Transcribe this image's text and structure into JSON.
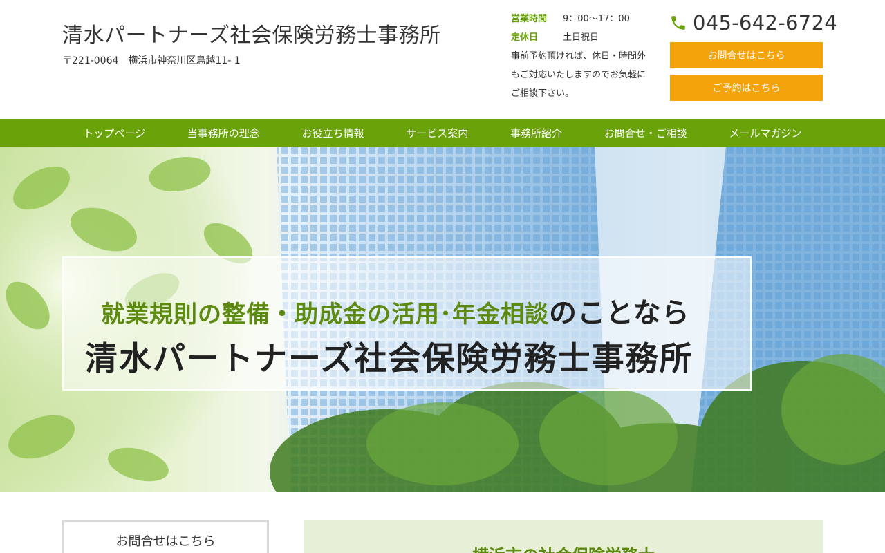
{
  "header": {
    "site_title": "清水パートナーズ社会保険労務士事務所",
    "address": "〒221-0064　横浜市神奈川区鳥越11- 1",
    "hours_label": "営業時間",
    "hours_value": "9：00〜17：00",
    "holiday_label": "定休日",
    "holiday_value": "土日祝日",
    "note_line1": "事前予約頂ければ、休日・時間外",
    "note_line2": "もご対応いたしますのでお気軽に",
    "note_line3": "ご相談下さい。",
    "phone_icon": "phone-icon",
    "phone": "045-642-6724",
    "contact_button": "お問合せはこちら",
    "reserve_button": "ご予約はこちら"
  },
  "nav": {
    "items": [
      {
        "label": "トップページ"
      },
      {
        "label": "当事務所の理念"
      },
      {
        "label": "お役立ち情報"
      },
      {
        "label": "サービス案内"
      },
      {
        "label": "事務所紹介"
      },
      {
        "label": "お問合せ・ご相談"
      },
      {
        "label": "メールマガジン"
      }
    ]
  },
  "hero": {
    "line1_accent": "就業規則の整備・助成金の活用･年金相談",
    "line1_plain": "のことなら",
    "line2": "清水パートナーズ社会保険労務士事務所"
  },
  "sidebar": {
    "box_title": "お問合せはこちら"
  },
  "main": {
    "heading": "横浜市の社会保険労務士"
  },
  "colors": {
    "accent_green": "#6aa20a",
    "button_orange": "#f5a30a"
  }
}
